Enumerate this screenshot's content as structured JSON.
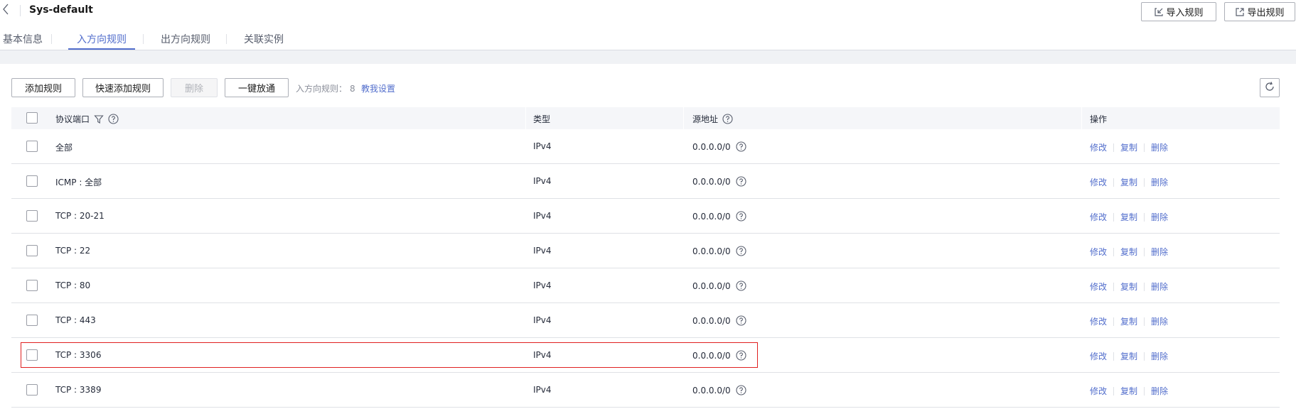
{
  "header": {
    "title": "Sys-default",
    "import_label": "导入规则",
    "export_label": "导出规则"
  },
  "tabs": [
    {
      "label": "基本信息",
      "active": false
    },
    {
      "label": "入方向规则",
      "active": true
    },
    {
      "label": "出方向规则",
      "active": false
    },
    {
      "label": "关联实例",
      "active": false
    }
  ],
  "toolbar": {
    "add_label": "添加规则",
    "quick_add_label": "快速添加规则",
    "delete_label": "删除",
    "allow_all_label": "一键放通",
    "rule_count_label": "入方向规则：",
    "rule_count": "8",
    "help_link": "教我设置"
  },
  "table": {
    "columns": [
      "协议端口",
      "类型",
      "源地址",
      "操作"
    ],
    "rows": [
      {
        "port": "全部",
        "type": "IPv4",
        "source": "0.0.0.0/0"
      },
      {
        "port": "ICMP : 全部",
        "type": "IPv4",
        "source": "0.0.0.0/0"
      },
      {
        "port": "TCP : 20-21",
        "type": "IPv4",
        "source": "0.0.0.0/0"
      },
      {
        "port": "TCP : 22",
        "type": "IPv4",
        "source": "0.0.0.0/0"
      },
      {
        "port": "TCP : 80",
        "type": "IPv4",
        "source": "0.0.0.0/0"
      },
      {
        "port": "TCP : 443",
        "type": "IPv4",
        "source": "0.0.0.0/0"
      },
      {
        "port": "TCP : 3306",
        "type": "IPv4",
        "source": "0.0.0.0/0"
      },
      {
        "port": "TCP : 3389",
        "type": "IPv4",
        "source": "0.0.0.0/0"
      }
    ],
    "actions": {
      "edit": "修改",
      "copy": "复制",
      "delete": "删除"
    }
  },
  "highlighted_row": "TCP : 3306",
  "icons": {
    "back": "chevron-left-icon",
    "import": "import-icon",
    "export": "export-icon",
    "refresh": "refresh-icon",
    "filter": "filter-icon",
    "help": "question-circle-icon"
  },
  "colors": {
    "accent": "#526ecc",
    "highlight_border": "#e02020",
    "header_bg": "#f5f6f9"
  }
}
